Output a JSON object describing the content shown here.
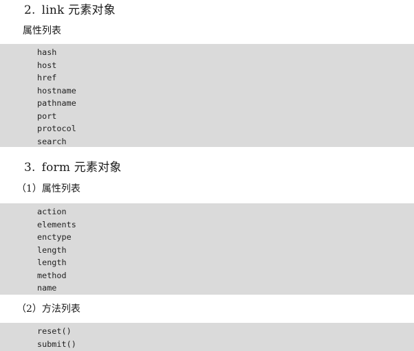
{
  "sections": [
    {
      "number": "2.",
      "title": "link 元素对象",
      "groups": [
        {
          "label": "属性列表",
          "items": [
            "hash",
            "host",
            "href",
            "hostname",
            "pathname",
            "port",
            "protocol",
            "search"
          ]
        }
      ]
    },
    {
      "number": "3.",
      "title": "form 元素对象",
      "groups": [
        {
          "label": "（1）属性列表",
          "items": [
            "action",
            "elements",
            "enctype",
            "length",
            "length",
            "method",
            "name"
          ]
        },
        {
          "label": "（2）方法列表",
          "items": [
            "reset()",
            "submit()"
          ]
        }
      ]
    }
  ]
}
